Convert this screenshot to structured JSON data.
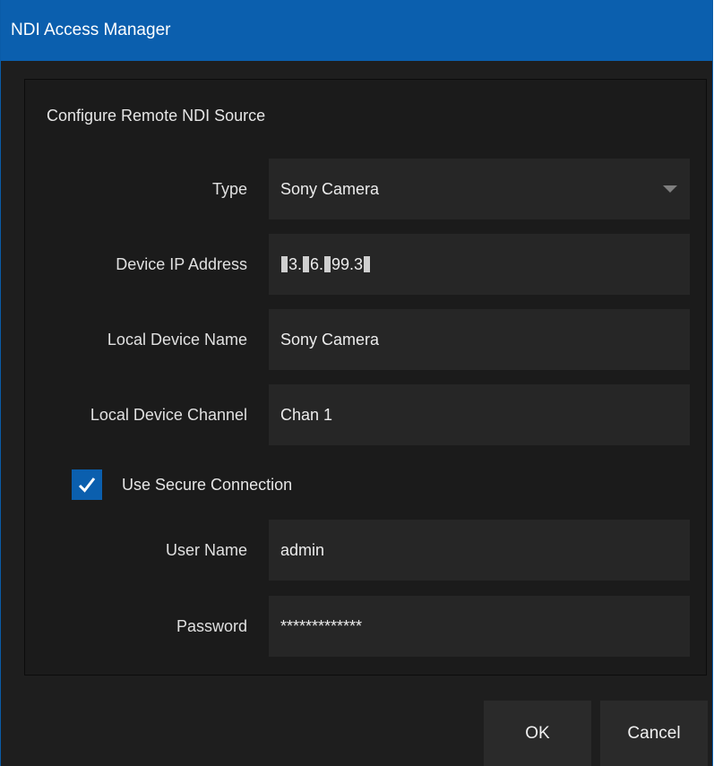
{
  "window": {
    "title": "NDI Access Manager"
  },
  "section": {
    "title": "Configure Remote NDI Source"
  },
  "fields": {
    "type": {
      "label": "Type",
      "value": "Sony Camera",
      "icon": "chevron-down-icon"
    },
    "ip": {
      "label": "Device IP Address",
      "parts": [
        "3.",
        "6.",
        "99.3"
      ]
    },
    "name": {
      "label": "Local Device Name",
      "value": "Sony Camera"
    },
    "channel": {
      "label": "Local Device Channel",
      "value": "Chan 1"
    },
    "secure": {
      "label": "Use Secure Connection",
      "checked": true
    },
    "user": {
      "label": "User Name",
      "value": "admin"
    },
    "password": {
      "label": "Password",
      "value": "*************"
    }
  },
  "buttons": {
    "ok": "OK",
    "cancel": "Cancel"
  },
  "colors": {
    "accent": "#0b5fae",
    "background": "#1e1e1e",
    "field": "#262626"
  }
}
